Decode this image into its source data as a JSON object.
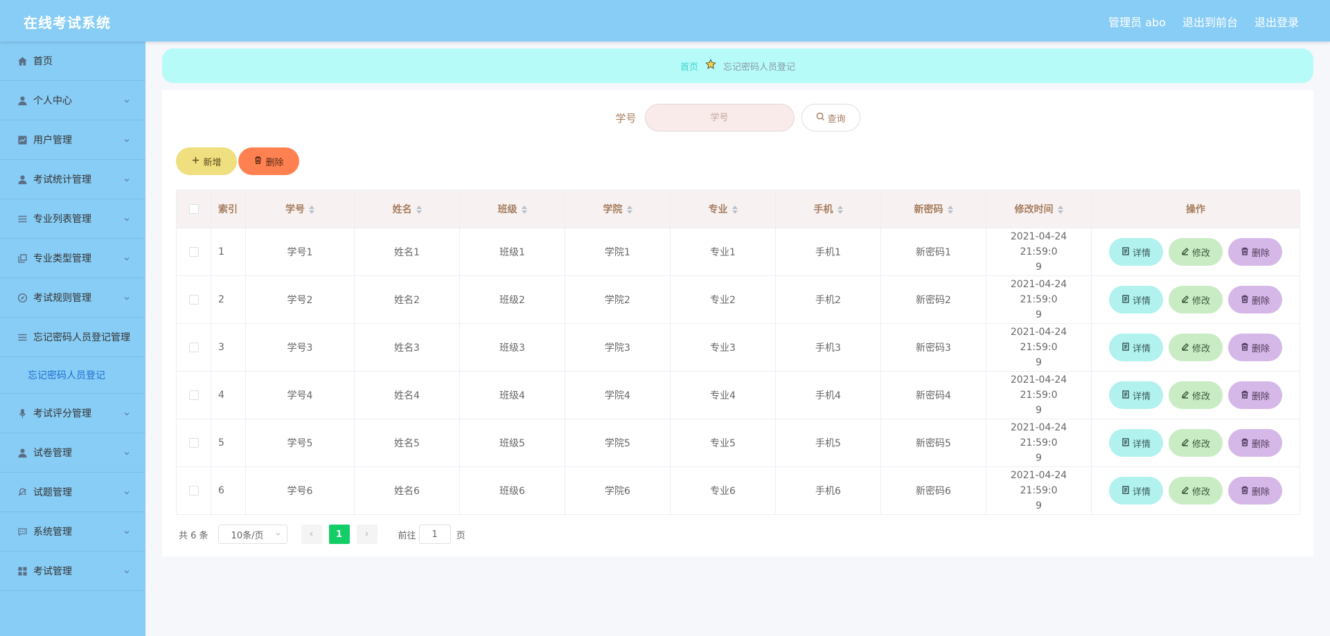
{
  "header": {
    "title": "在线考试系统",
    "links": [
      "管理员 abo",
      "退出到前台",
      "退出登录"
    ]
  },
  "sidebar": {
    "items": [
      {
        "label": "首页",
        "icon": "home-icon",
        "has_chevron": false
      },
      {
        "label": "个人中心",
        "icon": "user-icon",
        "has_chevron": true
      },
      {
        "label": "用户管理",
        "icon": "chart-icon",
        "has_chevron": true
      },
      {
        "label": "考试统计管理",
        "icon": "user-icon",
        "has_chevron": true
      },
      {
        "label": "专业列表管理",
        "icon": "list-icon",
        "has_chevron": true
      },
      {
        "label": "专业类型管理",
        "icon": "copy-icon",
        "has_chevron": true
      },
      {
        "label": "考试规则管理",
        "icon": "compass-icon",
        "has_chevron": true
      },
      {
        "label": "忘记密码人员登记管理",
        "icon": "list-icon",
        "has_chevron": false
      },
      {
        "label": "考试评分管理",
        "icon": "microphone-icon",
        "has_chevron": true
      },
      {
        "label": "试卷管理",
        "icon": "user-icon",
        "has_chevron": true
      },
      {
        "label": "试题管理",
        "icon": "bell-off-icon",
        "has_chevron": true
      },
      {
        "label": "系统管理",
        "icon": "chat-icon",
        "has_chevron": true
      },
      {
        "label": "考试管理",
        "icon": "grid-icon",
        "has_chevron": true
      }
    ],
    "active_submenu": "忘记密码人员登记"
  },
  "breadcrumb": {
    "home": "首页",
    "current": "忘记密码人员登记"
  },
  "search": {
    "label": "学号",
    "placeholder": "学号",
    "button": "查询"
  },
  "actions": {
    "add": "新增",
    "delete": "删除"
  },
  "table": {
    "columns": [
      "索引",
      "学号",
      "姓名",
      "班级",
      "学院",
      "专业",
      "手机",
      "新密码",
      "修改时间",
      "操作"
    ],
    "rows": [
      {
        "index": "1",
        "student_id": "学号1",
        "name": "姓名1",
        "class": "班级1",
        "college": "学院1",
        "major": "专业1",
        "phone": "手机1",
        "new_password": "新密码1",
        "time_line1": "2021-04-24 21:59:0",
        "time_line2": "9"
      },
      {
        "index": "2",
        "student_id": "学号2",
        "name": "姓名2",
        "class": "班级2",
        "college": "学院2",
        "major": "专业2",
        "phone": "手机2",
        "new_password": "新密码2",
        "time_line1": "2021-04-24 21:59:0",
        "time_line2": "9"
      },
      {
        "index": "3",
        "student_id": "学号3",
        "name": "姓名3",
        "class": "班级3",
        "college": "学院3",
        "major": "专业3",
        "phone": "手机3",
        "new_password": "新密码3",
        "time_line1": "2021-04-24 21:59:0",
        "time_line2": "9"
      },
      {
        "index": "4",
        "student_id": "学号4",
        "name": "姓名4",
        "class": "班级4",
        "college": "学院4",
        "major": "专业4",
        "phone": "手机4",
        "new_password": "新密码4",
        "time_line1": "2021-04-24 21:59:0",
        "time_line2": "9"
      },
      {
        "index": "5",
        "student_id": "学号5",
        "name": "姓名5",
        "class": "班级5",
        "college": "学院5",
        "major": "专业5",
        "phone": "手机5",
        "new_password": "新密码5",
        "time_line1": "2021-04-24 21:59:0",
        "time_line2": "9"
      },
      {
        "index": "6",
        "student_id": "学号6",
        "name": "姓名6",
        "class": "班级6",
        "college": "学院6",
        "major": "专业6",
        "phone": "手机6",
        "new_password": "新密码6",
        "time_line1": "2021-04-24 21:59:0",
        "time_line2": "9"
      }
    ],
    "row_actions": {
      "detail": "详情",
      "edit": "修改",
      "delete": "删除"
    }
  },
  "pagination": {
    "total": "共 6 条",
    "page_size": "10条/页",
    "current_page": "1",
    "goto_label": "前往",
    "goto_value": "1",
    "goto_suffix": "页"
  },
  "colors": {
    "header_bg": "#88cdf6",
    "breadcrumb_bg": "#b6fbf8",
    "add_button": "#f0df7e",
    "delete_button": "#ff8151",
    "detail_button": "#b1f1ee",
    "edit_button": "#c9ecc5",
    "row_delete_button": "#d6b8e8",
    "active_page": "#13ce66"
  }
}
